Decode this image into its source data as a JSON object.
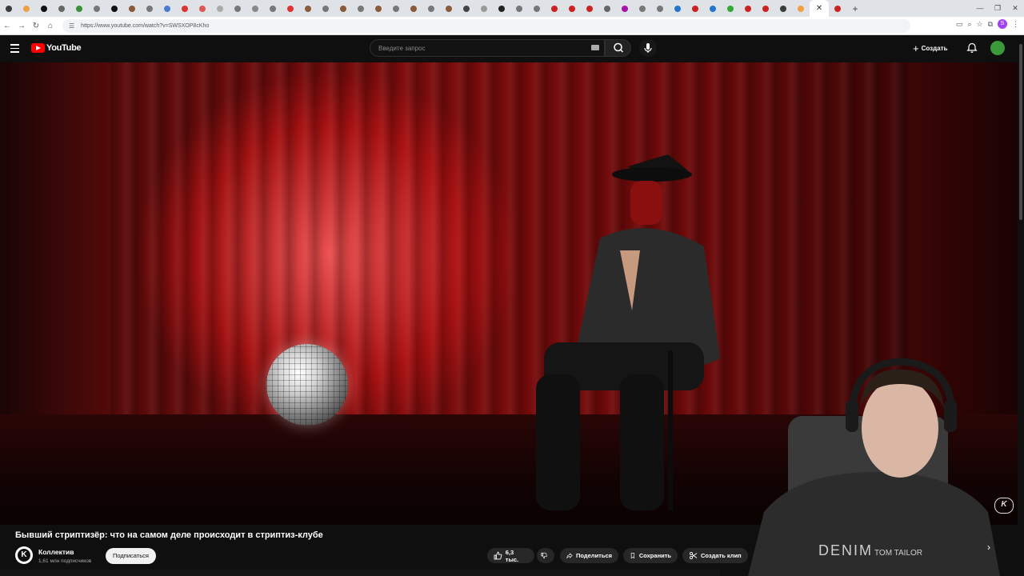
{
  "browser": {
    "tab_count": 48,
    "url": "https://www.youtube.com/watch?v=SWSXOP8cKho",
    "new_tab": "+",
    "window_controls": [
      "—",
      "❐",
      "✕"
    ]
  },
  "header": {
    "logo_text": "YouTube",
    "search_placeholder": "Введите запрос",
    "create_label": "Создать"
  },
  "video": {
    "title": "Бывший стриптизёр: что на самом деле происходит в стриптиз-клубе",
    "channel_name": "Коллектив",
    "subscribers": "1,61 млн подписчиков",
    "subscribe_label": "Подписаться",
    "likes": "6,3 тыс.",
    "share_label": "Поделиться",
    "save_label": "Сохранить",
    "clip_label": "Создать клип",
    "watermark": "K"
  },
  "colors": {
    "brand_red": "#ff0000",
    "background": "#0f0f0f"
  }
}
